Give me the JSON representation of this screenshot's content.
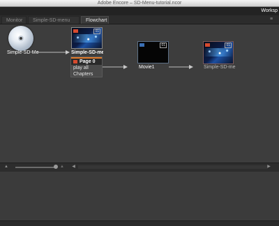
{
  "window": {
    "title": "Adobe Encore – SD-Menu-tutorial.ncor"
  },
  "menubar": {
    "workspace_label": "Worksp"
  },
  "tabs": [
    {
      "label": "Monitor",
      "active": false
    },
    {
      "label": "Simple-SD-menu",
      "active": false
    },
    {
      "label": "Flowchart",
      "active": true
    }
  ],
  "panel_menu_icon": "≡",
  "flowchart": {
    "disc": {
      "label": "Simple-SD-Me",
      "icon": "dvd-disc-icon"
    },
    "menu_node": {
      "label": "Simple-SD-me",
      "page_label": "Page 0",
      "buttons": [
        "play all",
        "Chapters"
      ],
      "badge": "01"
    },
    "timeline_node": {
      "label": "Movie1",
      "badge": "01"
    },
    "menu_node_2": {
      "label": "Simple-SD-me",
      "badge": "01"
    }
  },
  "colors": {
    "accent_orange": "#e07a2a",
    "background": "#3b3b3b",
    "tab_strip": "#2c2c2c"
  }
}
